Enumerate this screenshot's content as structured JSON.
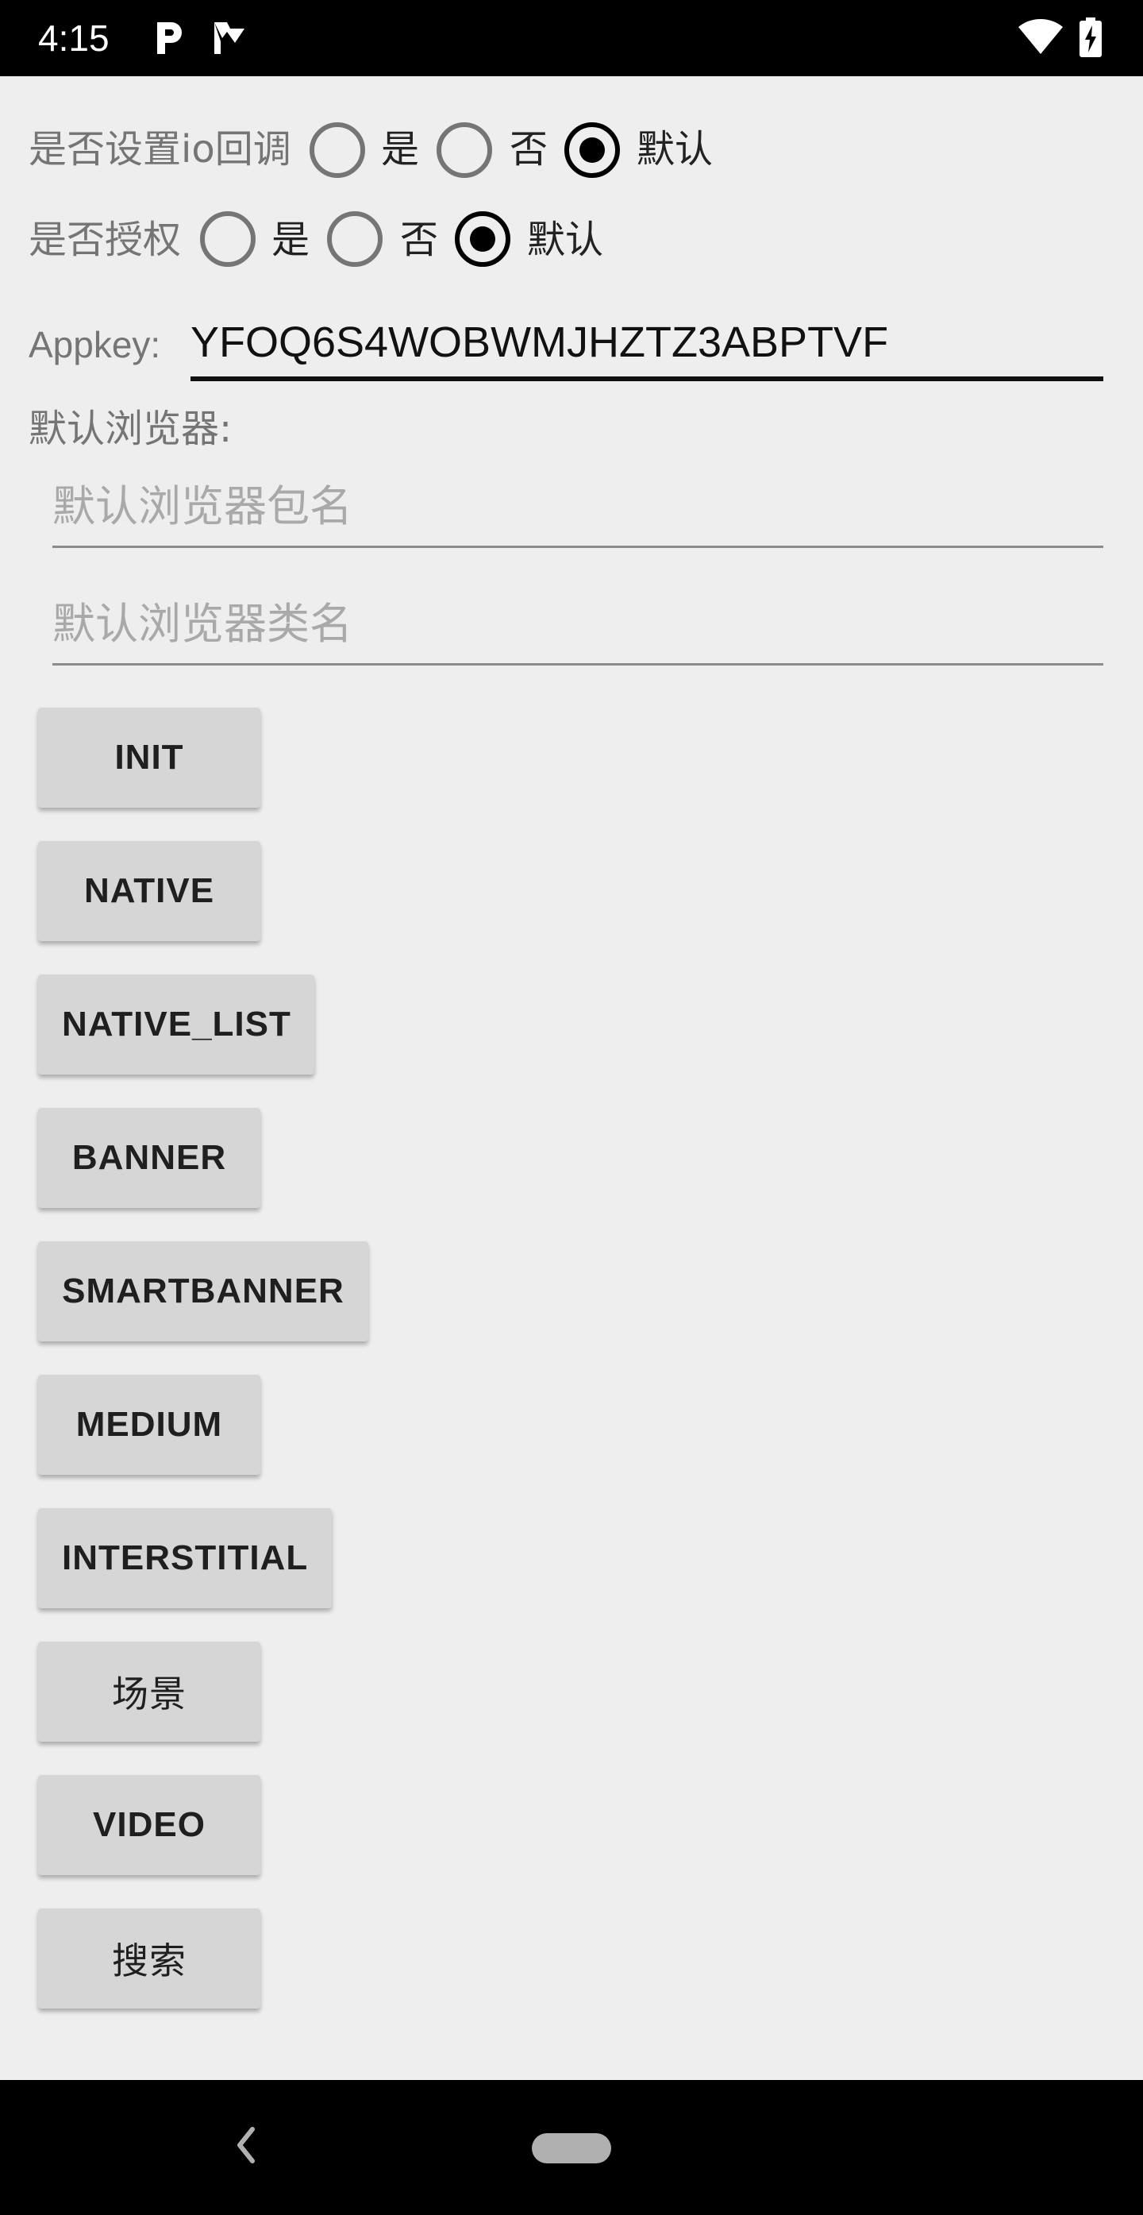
{
  "status_bar": {
    "time": "4:15",
    "app_icons": [
      "parking-icon",
      "check-flag-icon"
    ],
    "right_icons": [
      "wifi-icon",
      "battery-icon"
    ]
  },
  "io_callback": {
    "label": "是否设置io回调",
    "options": [
      "是",
      "否",
      "默认"
    ],
    "selected": "默认"
  },
  "authorize": {
    "label": "是否授权",
    "options": [
      "是",
      "否",
      "默认"
    ],
    "selected": "默认"
  },
  "appkey": {
    "label": "Appkey:",
    "value": "YFOQ6S4WOBWMJHZTZ3ABPTVF"
  },
  "default_browser": {
    "label": "默认浏览器:",
    "package_placeholder": "默认浏览器包名",
    "class_placeholder": "默认浏览器类名"
  },
  "buttons": [
    "INIT",
    "NATIVE",
    "NATIVE_LIST",
    "BANNER",
    "SMARTBANNER",
    "MEDIUM",
    "INTERSTITIAL",
    "场景",
    "VIDEO",
    "搜索"
  ],
  "colors": {
    "background": "#eeeeee",
    "button": "#d6d6d6",
    "bars": "#000000"
  }
}
